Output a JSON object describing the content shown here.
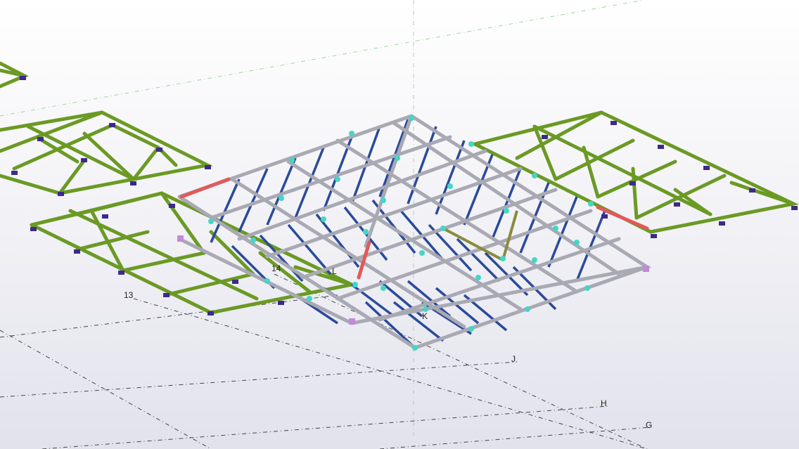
{
  "viewport": {
    "type": "3d-model-view",
    "background_colors": [
      "#ffffff",
      "#e2e2ec"
    ]
  },
  "grid_labels": {
    "g": "G",
    "h": "H",
    "j": "J",
    "k": "K",
    "l": "L",
    "n13": "13",
    "n14": "14"
  },
  "colors": {
    "truss_green": "#6b9a24",
    "truss_green_dark": "#4f7a12",
    "frame_gray": "#a9a9b4",
    "brace_blue": "#2a4a9a",
    "highlight_red": "#e05a5a",
    "joint_cyan": "#44d6c6",
    "support_purple": "#3c2a8a",
    "grid_line": "#444444",
    "grid_line_green": "#9ed79e"
  }
}
